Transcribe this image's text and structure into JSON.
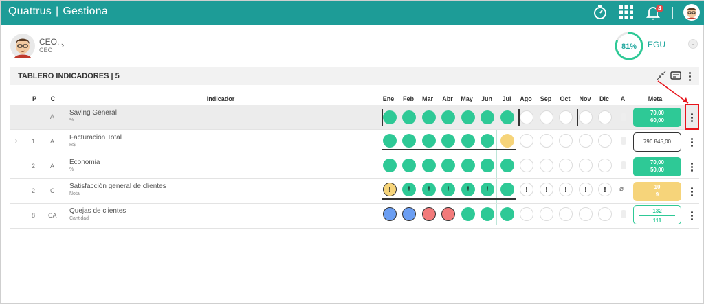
{
  "app": {
    "brand": "Quattrus",
    "separator": "|",
    "module": "Gestiona",
    "notification_count": "4"
  },
  "profile": {
    "name": "CEO,",
    "role": "CEO",
    "score": "81%",
    "score_value": 0.81,
    "unit_label": "EGU"
  },
  "board": {
    "title": "TABLERO INDICADORES | 5"
  },
  "columns": {
    "p": "P",
    "c": "C",
    "indicador": "Indicador",
    "months": [
      "Ene",
      "Feb",
      "Mar",
      "Abr",
      "May",
      "Jun",
      "Jul",
      "Ago",
      "Sep",
      "Oct",
      "Nov",
      "Dic"
    ],
    "a": "A",
    "meta": "Meta"
  },
  "rows": [
    {
      "p": "",
      "c": "A",
      "name": "Saving General",
      "unit": "%",
      "meta1": "70,00",
      "meta2": "60,00"
    },
    {
      "p": "1",
      "c": "A",
      "name": "Facturación Total",
      "unit": "R$",
      "meta1": "",
      "meta2": "796.845,00"
    },
    {
      "p": "2",
      "c": "A",
      "name": "Economia",
      "unit": "%",
      "meta1": "70,00",
      "meta2": "50,00"
    },
    {
      "p": "2",
      "c": "C",
      "name": "Satisfacción general de clientes",
      "unit": "Nota",
      "meta1": "10",
      "meta2": "9"
    },
    {
      "p": "8",
      "c": "CA",
      "name": "Quejas de clientes",
      "unit": "Cantidad",
      "meta1": "132",
      "meta2": "111"
    }
  ],
  "colors": {
    "header": "#1d9c97",
    "green": "#2ec996",
    "yellow": "#f6d47a",
    "red": "#f27a7a",
    "blue": "#6b9ef2",
    "highlight": "#e8151c"
  }
}
